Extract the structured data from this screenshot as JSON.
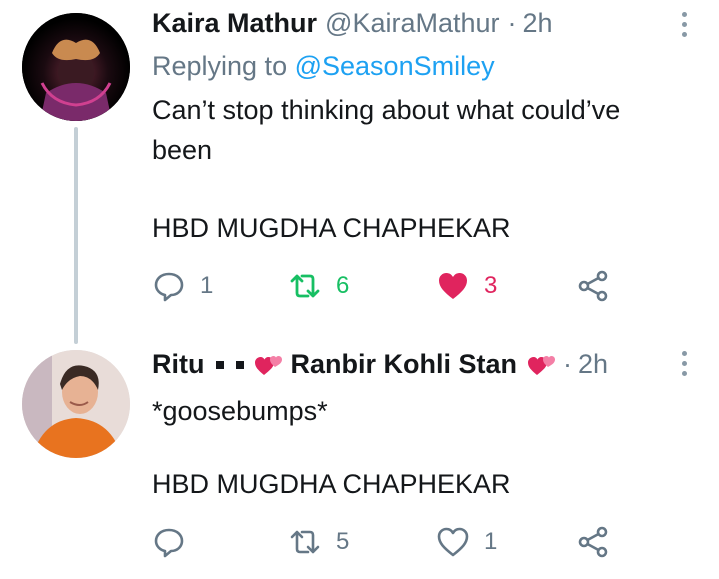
{
  "tweets": [
    {
      "author_name": "Kaira Mathur",
      "handle": "@KairaMathur",
      "separator": "·",
      "time": "2h",
      "replying_prefix": "Replying to",
      "replying_to": "@SeasonSmiley",
      "text_line1": "Can’t stop thinking about what could’ve",
      "text_line2": "been",
      "text_line3": "HBD MUGDHA CHAPHEKAR",
      "replies": "1",
      "retweets": "6",
      "likes": "3",
      "retweeted": true,
      "liked": true
    },
    {
      "author_name": "Ritu",
      "author_suffix": "Ranbir Kohli Stan",
      "separator": "·",
      "time": "2h",
      "text_line1": "*goosebumps*",
      "text_line2": "HBD MUGDHA CHAPHEKAR",
      "replies": "",
      "retweets": "5",
      "likes": "1",
      "retweeted": false,
      "liked": false
    }
  ],
  "colors": {
    "retweet_active": "#17bf63",
    "like_active": "#e0245e",
    "mention": "#1da1f2",
    "secondary_text": "#657786"
  },
  "icons": [
    "reply-icon",
    "retweet-icon",
    "like-icon",
    "share-icon",
    "more-icon",
    "heart-emoji"
  ]
}
